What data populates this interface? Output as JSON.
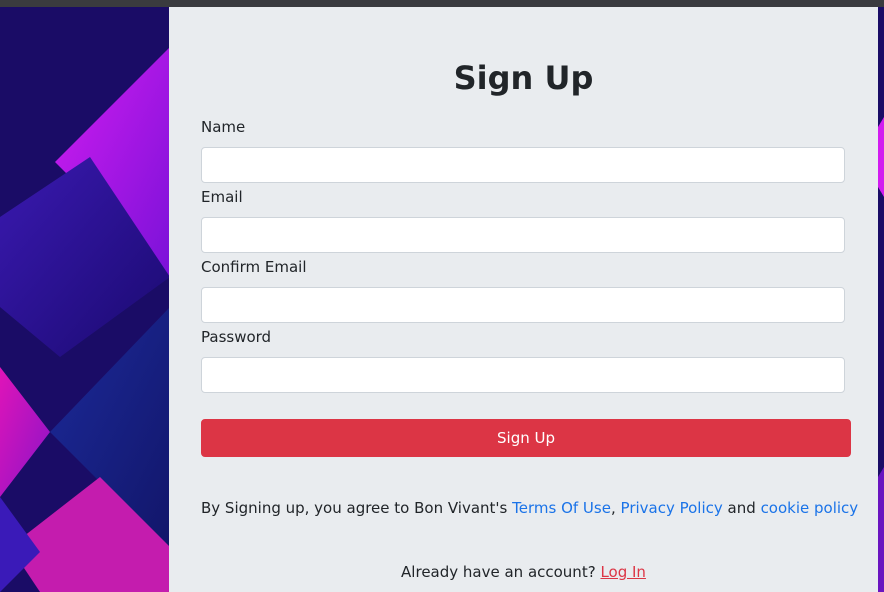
{
  "form": {
    "title": "Sign Up",
    "fields": [
      {
        "label": "Name",
        "value": "",
        "placeholder": ""
      },
      {
        "label": "Email",
        "value": "",
        "placeholder": ""
      },
      {
        "label": "Confirm Email",
        "value": "",
        "placeholder": ""
      },
      {
        "label": "Password",
        "value": "",
        "placeholder": ""
      }
    ],
    "submit_label": "Sign Up"
  },
  "terms": {
    "prefix": "By Signing up, you agree to Bon Vivant's",
    "terms_link": "Terms Of Use",
    "comma": ",",
    "privacy_link": "Privacy Policy",
    "and": "and",
    "cookie_link": "cookie policy"
  },
  "login": {
    "prompt": "Already have an account?",
    "link": "Log In"
  },
  "colors": {
    "card_bg": "#e9ecef",
    "primary_button": "#dc3545",
    "link_blue": "#1a73e8",
    "login_link": "#dc3545"
  }
}
